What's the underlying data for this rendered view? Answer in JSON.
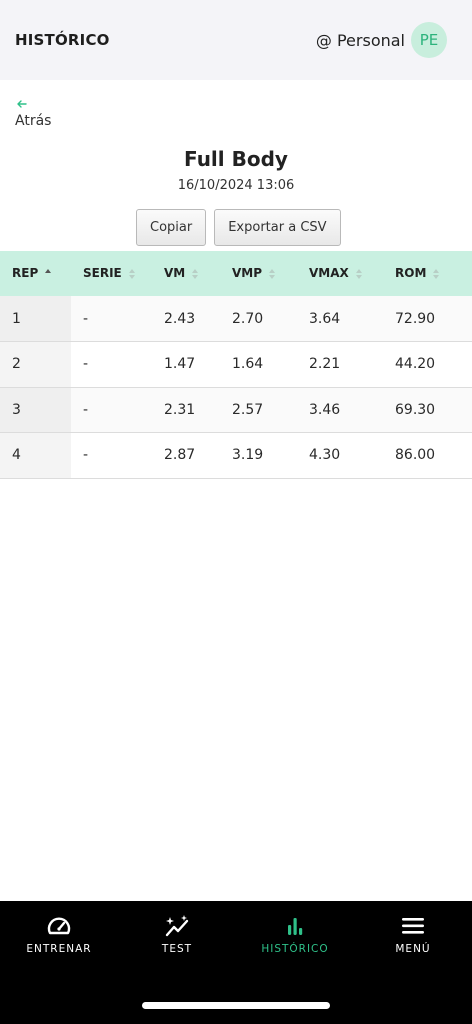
{
  "header": {
    "title": "HISTÓRICO",
    "profile_name": "@ Personal",
    "avatar_initials": "PE"
  },
  "back": {
    "label": "Atrás"
  },
  "session": {
    "title": "Full Body",
    "datetime": "16/10/2024 13:06"
  },
  "actions": {
    "copy_label": "Copiar",
    "export_label": "Exportar a CSV"
  },
  "table": {
    "columns": [
      "REP",
      "SERIE",
      "VM",
      "VMP",
      "VMAX",
      "ROM"
    ],
    "rows": [
      [
        "1",
        "-",
        "2.43",
        "2.70",
        "3.64",
        "72.90"
      ],
      [
        "2",
        "-",
        "1.47",
        "1.64",
        "2.21",
        "44.20"
      ],
      [
        "3",
        "-",
        "2.31",
        "2.57",
        "3.46",
        "69.30"
      ],
      [
        "4",
        "-",
        "2.87",
        "3.19",
        "4.30",
        "86.00"
      ]
    ]
  },
  "nav": {
    "items": [
      {
        "label": "ENTRENAR",
        "icon": "speedometer-icon"
      },
      {
        "label": "TEST",
        "icon": "sparkle-chart-icon"
      },
      {
        "label": "HISTÓRICO",
        "icon": "bar-chart-icon"
      },
      {
        "label": "MENÚ",
        "icon": "hamburger-menu-icon"
      }
    ]
  },
  "colors": {
    "accent": "#2fc089",
    "table_header_bg": "#c9f0e1",
    "header_bg": "#f4f4f8",
    "nav_bg": "#000000"
  }
}
